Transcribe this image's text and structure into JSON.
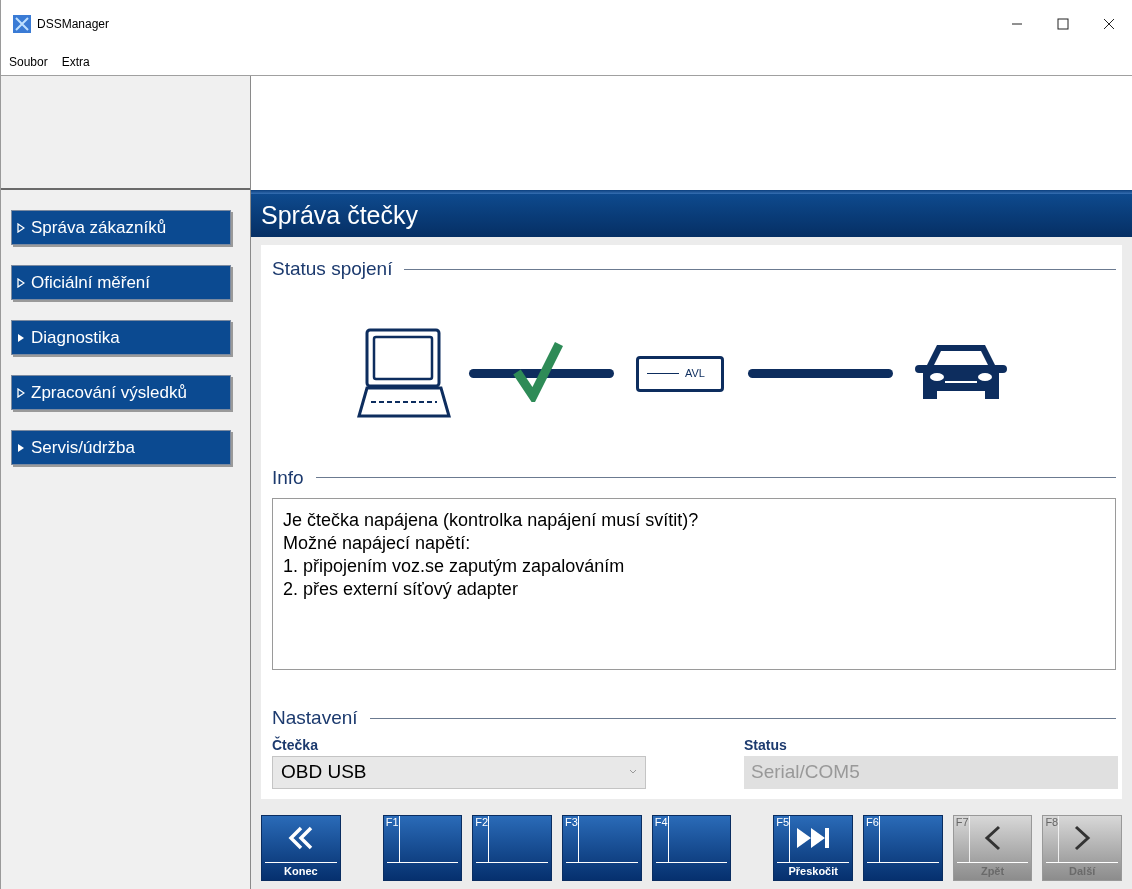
{
  "window": {
    "title": "DSSManager"
  },
  "menu": [
    "Soubor",
    "Extra"
  ],
  "sidebar": {
    "items": [
      {
        "label": "Správa zákazníků",
        "kind": "outline"
      },
      {
        "label": "Oficiální měření",
        "kind": "outline"
      },
      {
        "label": "Diagnostika",
        "kind": "solid"
      },
      {
        "label": "Zpracování výsledků",
        "kind": "outline"
      },
      {
        "label": "Servis/údržba",
        "kind": "solid"
      }
    ]
  },
  "page": {
    "title": "Správa čtečky",
    "status": {
      "heading": "Status spojení",
      "connected": true,
      "reader_label": "AVL"
    },
    "info": {
      "heading": "Info",
      "lines": [
        "Je čtečka napájena (kontrolka napájení musí svítit)?",
        "Možné napájecí napětí:",
        "1. připojením voz.se zaputým zapalováním",
        "2. přes externí síťový adapter"
      ]
    },
    "settings": {
      "heading": "Nastavení",
      "reader": {
        "label": "Čtečka",
        "value": "OBD USB"
      },
      "status": {
        "label": "Status",
        "value": "Serial/COM5"
      }
    }
  },
  "buttons": [
    {
      "kind": "back",
      "label": "Konec",
      "disabled": false
    },
    {
      "kind": "fkey",
      "key": "F1",
      "disabled": false
    },
    {
      "kind": "fkey",
      "key": "F2",
      "disabled": false
    },
    {
      "kind": "fkey",
      "key": "F3",
      "disabled": false
    },
    {
      "kind": "fkey",
      "key": "F4",
      "disabled": false
    },
    {
      "kind": "skip",
      "key": "F5",
      "label": "Přeskočit",
      "disabled": false
    },
    {
      "kind": "fkey",
      "key": "F6",
      "disabled": false
    },
    {
      "kind": "prev",
      "key": "F7",
      "label": "Zpět",
      "disabled": true
    },
    {
      "kind": "next",
      "key": "F8",
      "label": "Další",
      "disabled": true
    }
  ]
}
